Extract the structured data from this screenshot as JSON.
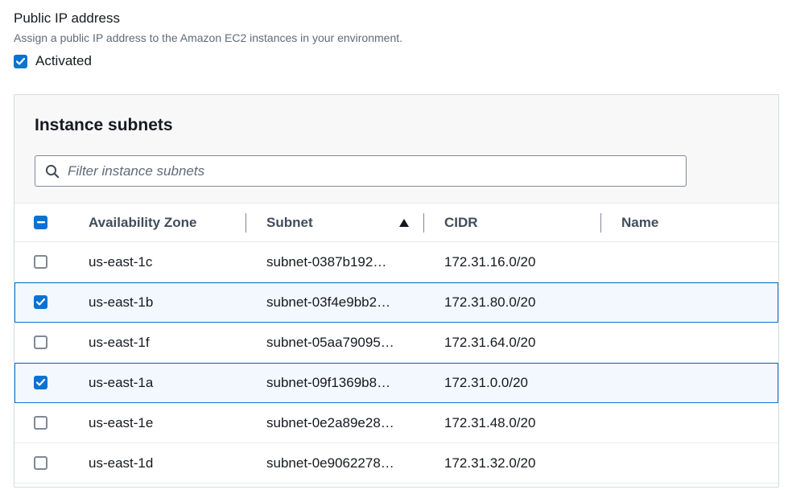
{
  "public_ip": {
    "title": "Public IP address",
    "description": "Assign a public IP address to the Amazon EC2 instances in your environment.",
    "checkbox_label": "Activated",
    "checked": true
  },
  "subnets": {
    "title": "Instance subnets",
    "filter_placeholder": "Filter instance subnets",
    "columns": {
      "availability_zone": "Availability Zone",
      "subnet": "Subnet",
      "cidr": "CIDR",
      "name": "Name"
    },
    "sorted_column": "subnet",
    "sort_direction": "ascending",
    "header_checkbox_state": "indeterminate",
    "rows": [
      {
        "az": "us-east-1c",
        "subnet": "subnet-0387b192…",
        "cidr": "172.31.16.0/20",
        "name": "",
        "selected": false
      },
      {
        "az": "us-east-1b",
        "subnet": "subnet-03f4e9bb2…",
        "cidr": "172.31.80.0/20",
        "name": "",
        "selected": true
      },
      {
        "az": "us-east-1f",
        "subnet": "subnet-05aa79095…",
        "cidr": "172.31.64.0/20",
        "name": "",
        "selected": false
      },
      {
        "az": "us-east-1a",
        "subnet": "subnet-09f1369b8…",
        "cidr": "172.31.0.0/20",
        "name": "",
        "selected": true
      },
      {
        "az": "us-east-1e",
        "subnet": "subnet-0e2a89e28…",
        "cidr": "172.31.48.0/20",
        "name": "",
        "selected": false
      },
      {
        "az": "us-east-1d",
        "subnet": "subnet-0e9062278…",
        "cidr": "172.31.32.0/20",
        "name": "",
        "selected": false
      }
    ]
  },
  "colors": {
    "accent": "#0972d3",
    "selected_row_bg": "#f2f8fd",
    "header_bg": "#f8f8f8",
    "text": "#16191f",
    "muted_text": "#5f6b7a"
  },
  "icons": {
    "filter": "search-icon",
    "sort": "sort-ascending-icon",
    "check": "checkmark-icon",
    "indeterminate": "minus-icon"
  }
}
